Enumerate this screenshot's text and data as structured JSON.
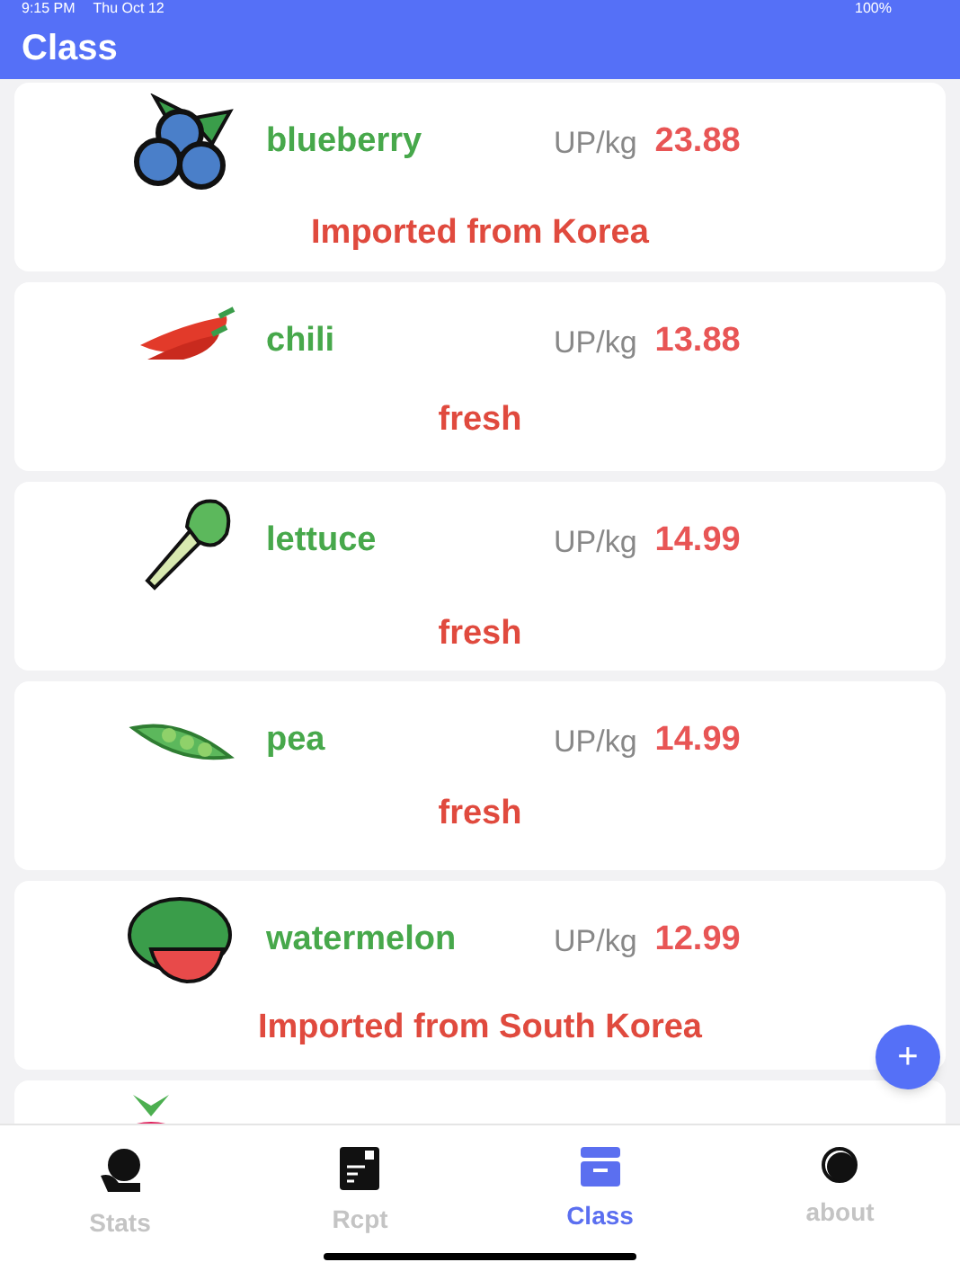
{
  "status_bar": {
    "time": "9:15 PM",
    "date": "Thu Oct 12",
    "battery": "100%"
  },
  "header": {
    "title": "Class"
  },
  "items": [
    {
      "kind": "blueberry",
      "name": "blueberry",
      "unit": "UP/kg",
      "price": "23.88",
      "note": "Imported from Korea"
    },
    {
      "kind": "chili",
      "name": "chili",
      "unit": "UP/kg",
      "price": "13.88",
      "note": "fresh"
    },
    {
      "kind": "lettuce",
      "name": "lettuce",
      "unit": "UP/kg",
      "price": "14.99",
      "note": "fresh"
    },
    {
      "kind": "pea",
      "name": "pea",
      "unit": "UP/kg",
      "price": "14.99",
      "note": "fresh"
    },
    {
      "kind": "watermelon",
      "name": "watermelon",
      "unit": "UP/kg",
      "price": "12.99",
      "note": "Imported from South Korea"
    }
  ],
  "partial_item": {
    "kind": "radish"
  },
  "fab": {
    "label": "+"
  },
  "tabs": [
    {
      "kind": "stats",
      "label": "Stats",
      "selected": false
    },
    {
      "kind": "receipt",
      "label": "Rcpt",
      "selected": false
    },
    {
      "kind": "box",
      "label": "Class",
      "selected": true
    },
    {
      "kind": "about",
      "label": "about",
      "selected": false
    }
  ]
}
